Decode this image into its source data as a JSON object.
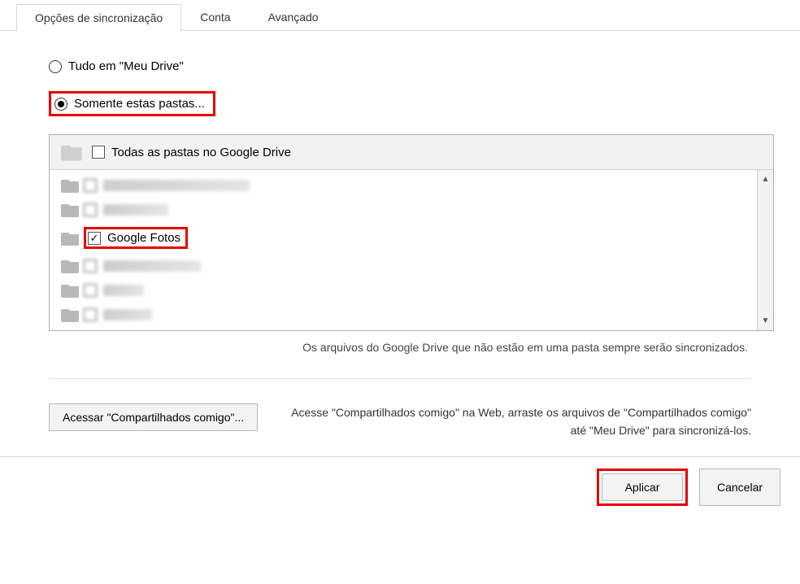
{
  "tabs": {
    "sync": "Opções de sincronização",
    "account": "Conta",
    "advanced": "Avançado"
  },
  "radios": {
    "all": "Tudo em \"Meu Drive\"",
    "only": "Somente estas pastas..."
  },
  "folderHeader": "Todas as pastas no Google Drive",
  "folders": {
    "googlePhotos": "Google Fotos"
  },
  "syncNote": "Os arquivos do Google Drive que não estão em uma pasta sempre serão sincronizados.",
  "sharedButton": "Acessar \"Compartilhados comigo\"...",
  "sharedText": "Acesse \"Compartilhados comigo\" na Web, arraste os arquivos de \"Compartilhados comigo\" até \"Meu Drive\" para sincronizá-los.",
  "buttons": {
    "apply": "Aplicar",
    "cancel": "Cancelar"
  }
}
